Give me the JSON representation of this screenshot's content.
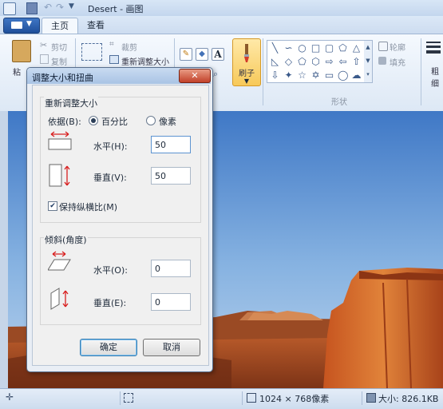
{
  "window": {
    "title": "Desert - 画图"
  },
  "tabs": {
    "home": "主页",
    "view": "查看"
  },
  "ribbon": {
    "paste": "粘",
    "cut": "剪切",
    "copy": "复制",
    "crop": "裁剪",
    "resize": "重新调整大小",
    "text_tool": "A",
    "brush": "刷子",
    "outline": "轮廓",
    "fill": "填充",
    "shapes_group": "形状",
    "size_label_1": "粗",
    "size_label_2": "细"
  },
  "dialog": {
    "title": "调整大小和扭曲",
    "close": "✕",
    "resize_group": "重新调整大小",
    "by_label": "依据(B):",
    "percent_option": "百分比",
    "pixels_option": "像素",
    "selected_unit": "百分比",
    "horizontal_label": "水平(H):",
    "horizontal_value": "50",
    "vertical_label": "垂直(V):",
    "vertical_value": "50",
    "keep_ratio_label": "保持纵横比(M)",
    "keep_ratio_checked": true,
    "skew_group": "倾斜(角度)",
    "skew_h_label": "水平(O):",
    "skew_h_value": "0",
    "skew_v_label": "垂直(E):",
    "skew_v_value": "0",
    "ok": "确定",
    "cancel": "取消"
  },
  "statusbar": {
    "dimensions": "1024 × 768像素",
    "size": "大小: 826.1KB"
  },
  "colors": {
    "accent": "#2b5ca8",
    "ribbon_bg": "#e7eef8",
    "brush_highlight": "#f7c95a"
  }
}
